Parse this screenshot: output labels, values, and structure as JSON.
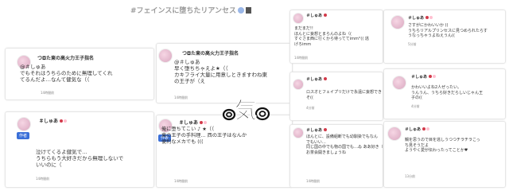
{
  "header": {
    "title": "#フェインスに堕ちたリアンセス"
  },
  "icons": [
    "circle-badge-icon",
    "building-icon",
    "avatar-icon"
  ],
  "stamp": {
    "text": "気"
  },
  "cards": [
    {
      "name": "つ◘た東の高火力王子指名",
      "handle": "@＃しゅあ",
      "text": "でもそれはうちらのために無理してくれ\nてるんだよ…なんて健気な（（",
      "time": "14時間前"
    },
    {
      "name": "つ◘た東の高火力王子指名",
      "handle": "@＃しゅあ",
      "text": "早く堕ちちゃえよ★（（\nカキフライ大量に用意しときますわね東\nの王子が（え",
      "time": "14時間前"
    },
    {
      "name": "＃しゅあ",
      "badge": "作者",
      "text": "泣けてくるよ健気で…\nうちらもう大好きだから無理しないで\nいいのに（",
      "time": "14時間前"
    },
    {
      "name": "＃しゅあ",
      "badge": "作者",
      "text": "俺に堕ちてこい ♪ ★（（\n東の王子の手料理… 西の王子はなんか\n便利なメカでも (((",
      "time": "14時間前"
    },
    {
      "name": "＃しゅあ",
      "text": "まだまだ!!\nほんとに妄想とまらんのよね（(\nすぐさま西に行くから待っててimm°(( 逃\nげろimm",
      "time": "14時間前"
    },
    {
      "name": "＃しゅあ",
      "text": "さすがにかわいいか ((\nうちらリアルプリンセスに見つめられたらす\nうなっちゃうよねえうん((",
      "time": "5分前"
    },
    {
      "name": "＃しゅあ",
      "text": "ロスオとフェイプリだけで永遠に妄想でき\nそ((",
      "time": "4分前"
    },
    {
      "name": "＃しゅあ",
      "text": "かわいいよね2人ぜったい。\nうんうん、うちら好きだらしいじゃん王\n子の((",
      "time": "4分前"
    },
    {
      "name": "＃しゅあ",
      "text": "ほんとに、設備組断でも幼馴染でもなん\nでもいい…\n同じ国の中でも物の国でも…ゐ ああ好き（\nお茶会開きましょうね",
      "time": "14時間前"
    },
    {
      "name": "＃しゅあ",
      "text": "鯛を思うので目を逃しうつつチラチラこっ\nち見そうだよ\nようやく愛が伝わったってことか♥",
      "time": "13分前"
    }
  ]
}
